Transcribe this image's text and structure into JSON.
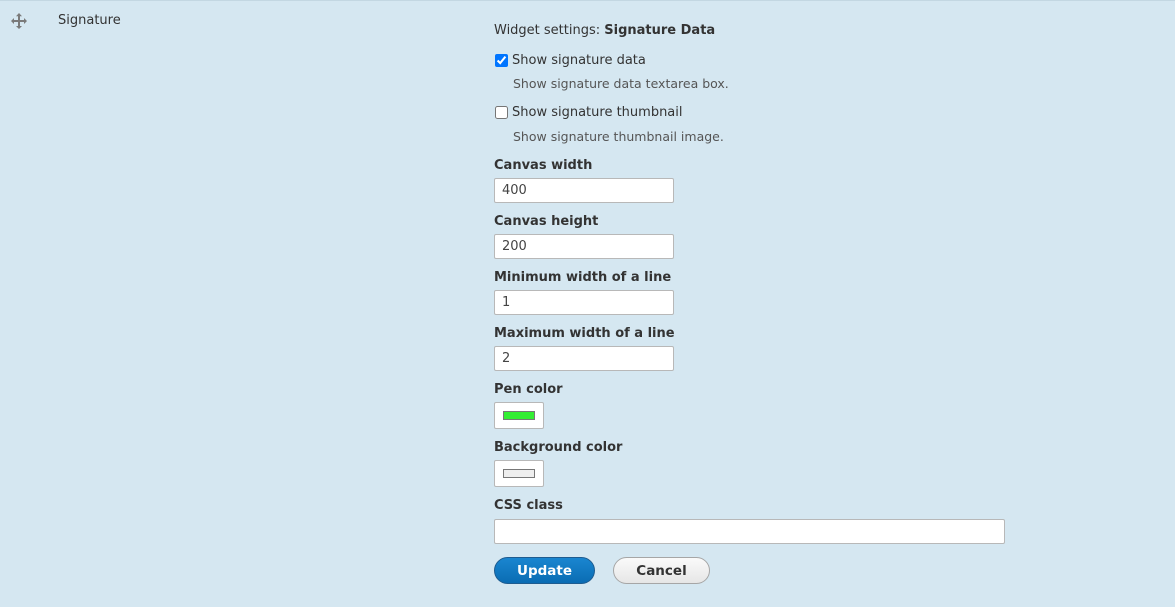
{
  "field": {
    "name": "Signature",
    "drag_icon": "move-icon"
  },
  "widget": {
    "title_prefix": "Widget settings: ",
    "title_name": "Signature Data"
  },
  "options": [
    {
      "label": "Show signature data",
      "checked": true,
      "description": "Show signature data textarea box."
    },
    {
      "label": "Show signature thumbnail",
      "checked": false,
      "description": "Show signature thumbnail image."
    }
  ],
  "fields": {
    "canvas_width": {
      "label": "Canvas width",
      "value": "400"
    },
    "canvas_height": {
      "label": "Canvas height",
      "value": "200"
    },
    "min_line_width": {
      "label": "Minimum width of a line",
      "value": "1"
    },
    "max_line_width": {
      "label": "Maximum width of a line",
      "value": "2"
    },
    "pen_color": {
      "label": "Pen color",
      "value": "#33ee33"
    },
    "background_color": {
      "label": "Background color",
      "value": "#eeeeee"
    },
    "css_class": {
      "label": "CSS class",
      "value": ""
    }
  },
  "buttons": {
    "update": "Update",
    "cancel": "Cancel"
  }
}
